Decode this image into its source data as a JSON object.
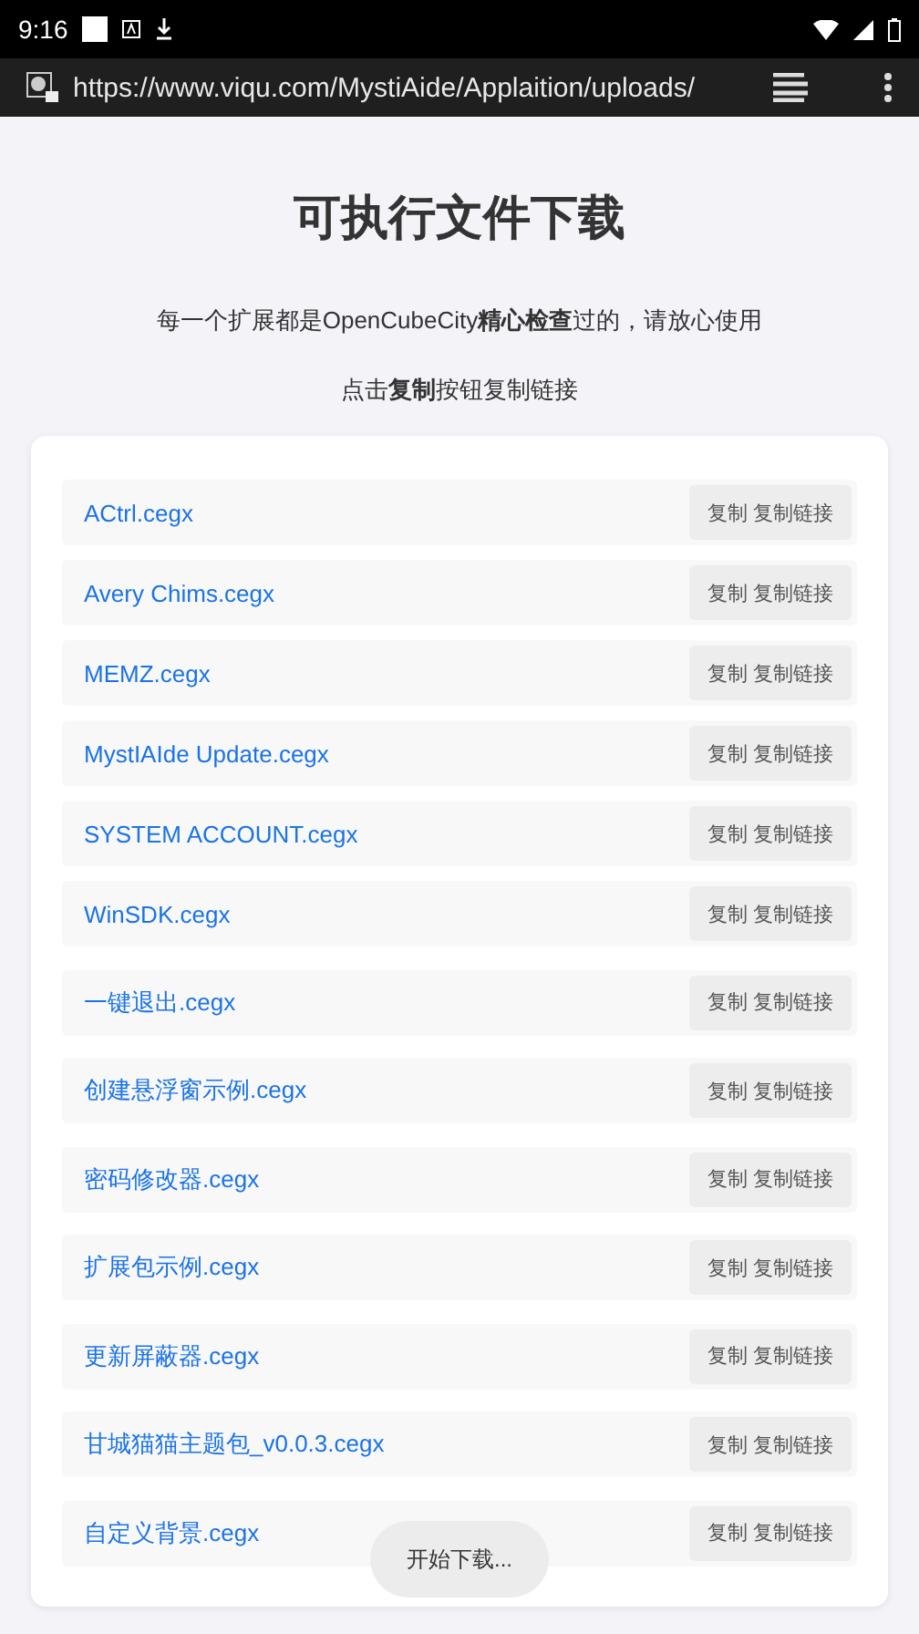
{
  "status_bar": {
    "time": "9:16"
  },
  "browser": {
    "url": "https://www.viqu.com/MystiAide/Applaition/uploads/"
  },
  "page": {
    "title": "可执行文件下载",
    "notes": [
      "每一个扩展都是OpenCubeCity**精心检查**过的，请放心使用",
      "点击**复制**按钮复制链接"
    ]
  },
  "files": [
    {
      "name": "ACtrl.cegx",
      "button": "复制 复制链接"
    },
    {
      "name": "Avery Chims.cegx",
      "button": "复制 复制链接"
    },
    {
      "name": "MEMZ.cegx",
      "button": "复制 复制链接"
    },
    {
      "name": "MystIAIde Update.cegx",
      "button": "复制 复制链接"
    },
    {
      "name": "SYSTEM ACCOUNT.cegx",
      "button": "复制 复制链接"
    },
    {
      "name": "WinSDK.cegx",
      "button": "复制 复制链接"
    },
    {
      "name": "一键退出.cegx",
      "button": "复制 复制链接"
    },
    {
      "name": "创建悬浮窗示例.cegx",
      "button": "复制 复制链接"
    },
    {
      "name": "密码修改器.cegx",
      "button": "复制 复制链接"
    },
    {
      "name": "扩展包示例.cegx",
      "button": "复制 复制链接"
    },
    {
      "name": "更新屏蔽器.cegx",
      "button": "复制 复制链接"
    },
    {
      "name": "甘城猫猫主题包_v0.0.3.cegx",
      "button": "复制 复制链接"
    },
    {
      "name": "自定义背景.cegx",
      "button": "复制 复制链接"
    }
  ],
  "toast": "开始下载..."
}
